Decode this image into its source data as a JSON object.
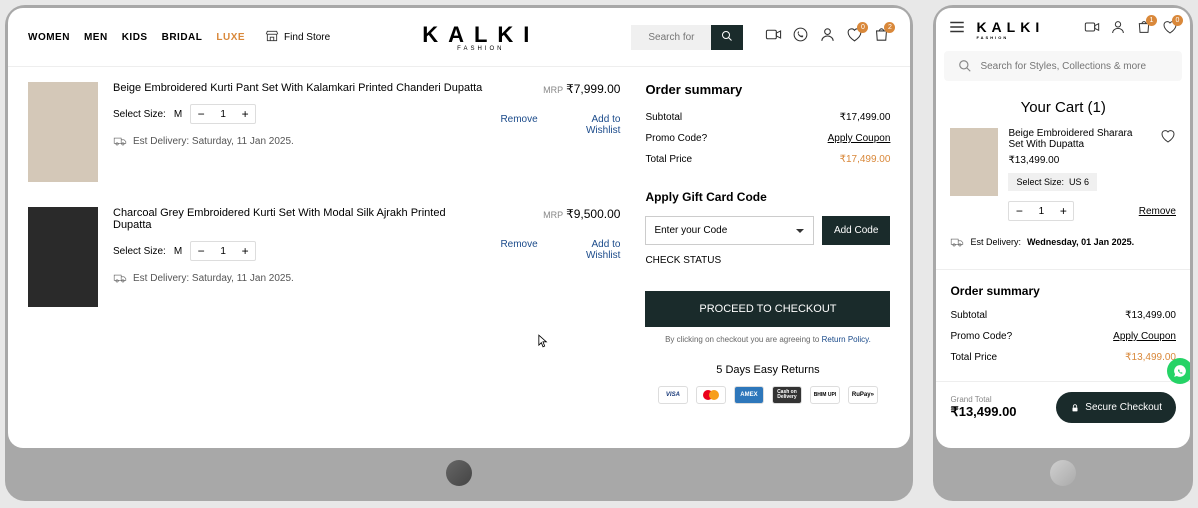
{
  "desktop": {
    "nav": {
      "women": "WOMEN",
      "men": "MEN",
      "kids": "KIDS",
      "bridal": "BRIDAL",
      "luxe": "LUXE",
      "findStore": "Find Store"
    },
    "logo": {
      "main": "KALKI",
      "sub": "FASHION"
    },
    "search": {
      "placeholder": "Search for"
    },
    "badges": {
      "wishlist": "0",
      "cart": "2"
    },
    "items": [
      {
        "name": "Beige Embroidered Kurti Pant Set With Kalamkari Printed Chanderi Dupatta",
        "sizeLabel": "Select Size:",
        "size": "M",
        "qty": "1",
        "delivery": "Est Delivery: Saturday, 11 Jan 2025.",
        "mrpLabel": "MRP",
        "price": "₹7,999.00",
        "remove": "Remove",
        "wishlist": "Add to Wishlist"
      },
      {
        "name": "Charcoal Grey Embroidered Kurti Set With Modal Silk Ajrakh Printed Dupatta",
        "sizeLabel": "Select Size:",
        "size": "M",
        "qty": "1",
        "delivery": "Est Delivery: Saturday, 11 Jan 2025.",
        "mrpLabel": "MRP",
        "price": "₹9,500.00",
        "remove": "Remove",
        "wishlist": "Add to Wishlist"
      }
    ],
    "summary": {
      "title": "Order summary",
      "subtotalLabel": "Subtotal",
      "subtotal": "₹17,499.00",
      "promoLabel": "Promo Code?",
      "applyCoupon": "Apply Coupon",
      "totalLabel": "Total Price",
      "total": "₹17,499.00",
      "giftTitle": "Apply Gift Card Code",
      "giftPlaceholder": "Enter your Code",
      "addCode": "Add Code",
      "checkStatus": "CHECK STATUS",
      "checkout": "PROCEED TO CHECKOUT",
      "agree": "By clicking on checkout you are agreeing to ",
      "returnPolicy": "Return Policy.",
      "easyReturns": "5 Days Easy Returns",
      "pay": {
        "visa": "VISA",
        "amex": "AMEX",
        "cod": "Cash on Delivery",
        "bhim": "BHIM UPI",
        "rupay": "RuPay»"
      }
    }
  },
  "mobile": {
    "logo": {
      "main": "KALKI",
      "sub": "FASHION"
    },
    "badges": {
      "cart": "1",
      "wishlist": "0"
    },
    "searchPlaceholder": "Search for Styles, Collections & more",
    "cartTitle": "Your Cart (1)",
    "item": {
      "name": "Beige Embroidered Sharara Set With Dupatta",
      "price": "₹13,499.00",
      "sizeLabel": "Select Size:",
      "size": "US 6",
      "qty": "1",
      "remove": "Remove"
    },
    "delivery": {
      "label": "Est Delivery: ",
      "date": "Wednesday, 01 Jan 2025."
    },
    "summary": {
      "title": "Order summary",
      "subtotalLabel": "Subtotal",
      "subtotal": "₹13,499.00",
      "promoLabel": "Promo Code?",
      "applyCoupon": "Apply Coupon",
      "totalLabel": "Total Price",
      "total": "₹13,499.00"
    },
    "footer": {
      "grandLabel": "Grand Total",
      "grandTotal": "₹13,499.00",
      "checkout": "Secure Checkout"
    }
  }
}
